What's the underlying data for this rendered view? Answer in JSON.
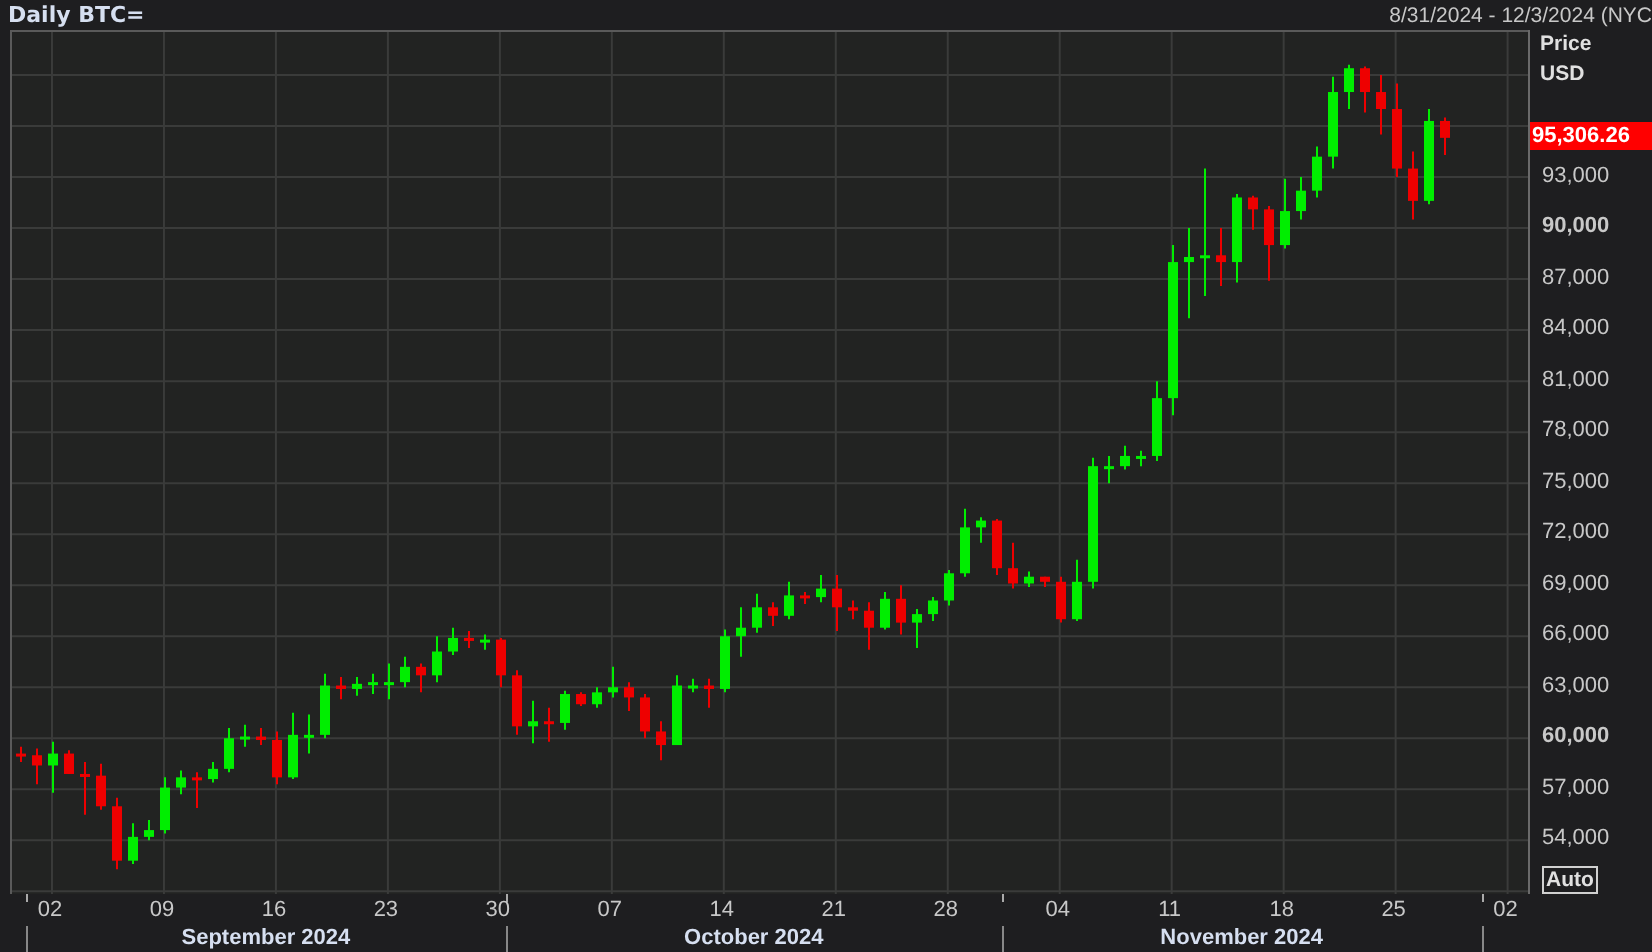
{
  "header": {
    "date_range": "8/31/2024 - 12/3/2024 (NYC"
  },
  "price_axis": {
    "title": "Price",
    "unit": "USD",
    "last_price": "95,306.26",
    "scale_mode": "Auto"
  },
  "months": [
    "September 2024",
    "October 2024",
    "November 2024"
  ],
  "chart": {
    "chart_data": {
      "type": "candlestick",
      "title": "Daily BTC=",
      "grid": true,
      "x": [
        "2024-08-31",
        "2024-09-01",
        "2024-09-02",
        "2024-09-03",
        "2024-09-04",
        "2024-09-05",
        "2024-09-06",
        "2024-09-07",
        "2024-09-08",
        "2024-09-09",
        "2024-09-10",
        "2024-09-11",
        "2024-09-12",
        "2024-09-13",
        "2024-09-14",
        "2024-09-15",
        "2024-09-16",
        "2024-09-17",
        "2024-09-18",
        "2024-09-19",
        "2024-09-20",
        "2024-09-21",
        "2024-09-22",
        "2024-09-23",
        "2024-09-24",
        "2024-09-25",
        "2024-09-26",
        "2024-09-27",
        "2024-09-28",
        "2024-09-29",
        "2024-09-30",
        "2024-10-01",
        "2024-10-02",
        "2024-10-03",
        "2024-10-04",
        "2024-10-05",
        "2024-10-06",
        "2024-10-07",
        "2024-10-08",
        "2024-10-09",
        "2024-10-10",
        "2024-10-11",
        "2024-10-12",
        "2024-10-13",
        "2024-10-14",
        "2024-10-15",
        "2024-10-16",
        "2024-10-17",
        "2024-10-18",
        "2024-10-19",
        "2024-10-20",
        "2024-10-21",
        "2024-10-22",
        "2024-10-23",
        "2024-10-24",
        "2024-10-25",
        "2024-10-26",
        "2024-10-27",
        "2024-10-28",
        "2024-10-29",
        "2024-10-30",
        "2024-10-31",
        "2024-11-01",
        "2024-11-02",
        "2024-11-03",
        "2024-11-04",
        "2024-11-05",
        "2024-11-06",
        "2024-11-07",
        "2024-11-08",
        "2024-11-09",
        "2024-11-10",
        "2024-11-11",
        "2024-11-12",
        "2024-11-13",
        "2024-11-14",
        "2024-11-15",
        "2024-11-16",
        "2024-11-17",
        "2024-11-18",
        "2024-11-19",
        "2024-11-20",
        "2024-11-21",
        "2024-11-22",
        "2024-11-23",
        "2024-11-24",
        "2024-11-25",
        "2024-11-26",
        "2024-11-27",
        "2024-11-28"
      ],
      "ohlc": [
        [
          59100,
          59500,
          58600,
          59000
        ],
        [
          59000,
          59400,
          57300,
          58400
        ],
        [
          58400,
          59800,
          56800,
          59100
        ],
        [
          59100,
          59300,
          57900,
          57900
        ],
        [
          57900,
          58600,
          55500,
          57800
        ],
        [
          57800,
          58500,
          55800,
          56000
        ],
        [
          56000,
          56500,
          52300,
          52800
        ],
        [
          52800,
          55000,
          52600,
          54200
        ],
        [
          54200,
          55200,
          54000,
          54600
        ],
        [
          54600,
          57700,
          54400,
          57100
        ],
        [
          57100,
          58100,
          56700,
          57700
        ],
        [
          57700,
          58000,
          55900,
          57600
        ],
        [
          57600,
          58600,
          57400,
          58200
        ],
        [
          58200,
          60600,
          58000,
          60000
        ],
        [
          60000,
          60800,
          59500,
          60100
        ],
        [
          60100,
          60600,
          59600,
          59900
        ],
        [
          59900,
          60400,
          57300,
          57700
        ],
        [
          57700,
          61500,
          57600,
          60200
        ],
        [
          60200,
          61400,
          59100,
          60200
        ],
        [
          60200,
          63800,
          60000,
          63100
        ],
        [
          63100,
          63600,
          62300,
          62900
        ],
        [
          62900,
          63600,
          62500,
          63200
        ],
        [
          63200,
          63800,
          62600,
          63300
        ],
        [
          63300,
          64400,
          62300,
          63300
        ],
        [
          63300,
          64800,
          63000,
          64200
        ],
        [
          64200,
          64400,
          62700,
          63700
        ],
        [
          63700,
          66000,
          63300,
          65100
        ],
        [
          65100,
          66500,
          64900,
          65900
        ],
        [
          65900,
          66300,
          65300,
          65800
        ],
        [
          65800,
          66100,
          65200,
          65800
        ],
        [
          65800,
          65900,
          63000,
          63700
        ],
        [
          63700,
          64000,
          60200,
          60700
        ],
        [
          60700,
          62200,
          59700,
          61000
        ],
        [
          61000,
          61800,
          59800,
          60900
        ],
        [
          60900,
          62800,
          60500,
          62600
        ],
        [
          62600,
          62700,
          61900,
          62000
        ],
        [
          62000,
          63000,
          61800,
          62700
        ],
        [
          62700,
          64200,
          62400,
          63000
        ],
        [
          63000,
          63300,
          61600,
          62400
        ],
        [
          62400,
          62600,
          60000,
          60400
        ],
        [
          60400,
          61000,
          58700,
          59600
        ],
        [
          59600,
          63700,
          59600,
          63100
        ],
        [
          63100,
          63500,
          62700,
          63100
        ],
        [
          63100,
          63500,
          61800,
          62900
        ],
        [
          62900,
          66400,
          62700,
          66000
        ],
        [
          66000,
          67700,
          64800,
          66500
        ],
        [
          66500,
          68500,
          66200,
          67700
        ],
        [
          67700,
          68000,
          66600,
          67200
        ],
        [
          67200,
          69200,
          67000,
          68400
        ],
        [
          68400,
          68600,
          67900,
          68300
        ],
        [
          68300,
          69600,
          68000,
          68800
        ],
        [
          68800,
          69600,
          66300,
          67700
        ],
        [
          67700,
          68100,
          67000,
          67500
        ],
        [
          67500,
          68000,
          65200,
          66500
        ],
        [
          66500,
          68600,
          66400,
          68200
        ],
        [
          68200,
          69000,
          66100,
          66800
        ],
        [
          66800,
          67600,
          65300,
          67300
        ],
        [
          67300,
          68300,
          66900,
          68100
        ],
        [
          68100,
          69900,
          67800,
          69700
        ],
        [
          69700,
          73500,
          69500,
          72400
        ],
        [
          72400,
          73000,
          71500,
          72800
        ],
        [
          72800,
          72900,
          69600,
          70000
        ],
        [
          70000,
          71500,
          68800,
          69100
        ],
        [
          69100,
          69800,
          68900,
          69500
        ],
        [
          69500,
          69500,
          68900,
          69200
        ],
        [
          69200,
          69500,
          66800,
          67000
        ],
        [
          67000,
          70500,
          66900,
          69200
        ],
        [
          69200,
          76500,
          68800,
          76000
        ],
        [
          76000,
          76600,
          75000,
          76000
        ],
        [
          76000,
          77200,
          75800,
          76600
        ],
        [
          76600,
          76900,
          76000,
          76600
        ],
        [
          76600,
          81000,
          76300,
          80000
        ],
        [
          80000,
          89000,
          79000,
          88000
        ],
        [
          88000,
          90000,
          84700,
          88300
        ],
        [
          88300,
          93500,
          86000,
          88400
        ],
        [
          88400,
          90000,
          86600,
          88000
        ],
        [
          88000,
          92000,
          86800,
          91800
        ],
        [
          91800,
          91900,
          89900,
          91100
        ],
        [
          91100,
          91300,
          86900,
          89000
        ],
        [
          89000,
          92900,
          88800,
          91000
        ],
        [
          91000,
          93000,
          90500,
          92200
        ],
        [
          92200,
          94800,
          91800,
          94200
        ],
        [
          94200,
          98900,
          93500,
          98000
        ],
        [
          98000,
          99600,
          97000,
          99400
        ],
        [
          99400,
          99500,
          96800,
          98000
        ],
        [
          98000,
          99000,
          95500,
          97000
        ],
        [
          97000,
          98500,
          93000,
          93500
        ],
        [
          93500,
          94500,
          90500,
          91600
        ],
        [
          91600,
          97000,
          91400,
          96300
        ],
        [
          96300,
          96500,
          94300,
          95306
        ]
      ],
      "xlim": [
        "2024-08-30T12:00:00Z",
        "2024-12-03T09:36:00Z"
      ],
      "ylim": [
        50724,
        101530
      ],
      "xticks": [
        {
          "value": "2024-09-02",
          "label": "02"
        },
        {
          "value": "2024-09-09",
          "label": "09"
        },
        {
          "value": "2024-09-16",
          "label": "16"
        },
        {
          "value": "2024-09-23",
          "label": "23"
        },
        {
          "value": "2024-09-30",
          "label": "30"
        },
        {
          "value": "2024-10-07",
          "label": "07"
        },
        {
          "value": "2024-10-14",
          "label": "14"
        },
        {
          "value": "2024-10-21",
          "label": "21"
        },
        {
          "value": "2024-10-28",
          "label": "28"
        },
        {
          "value": "2024-11-04",
          "label": "04"
        },
        {
          "value": "2024-11-11",
          "label": "11"
        },
        {
          "value": "2024-11-18",
          "label": "18"
        },
        {
          "value": "2024-11-25",
          "label": "25"
        },
        {
          "value": "2024-12-02",
          "label": "02"
        }
      ],
      "yticks": [
        {
          "value": 54000,
          "label": "54,000"
        },
        {
          "value": 57000,
          "label": "57,000"
        },
        {
          "value": 60000,
          "label": "60,000"
        },
        {
          "value": 63000,
          "label": "63,000"
        },
        {
          "value": 66000,
          "label": "66,000"
        },
        {
          "value": 69000,
          "label": "69,000"
        },
        {
          "value": 72000,
          "label": "72,000"
        },
        {
          "value": 75000,
          "label": "75,000"
        },
        {
          "value": 78000,
          "label": "78,000"
        },
        {
          "value": 81000,
          "label": "81,000"
        },
        {
          "value": 84000,
          "label": "84,000"
        },
        {
          "value": 87000,
          "label": "87,000"
        },
        {
          "value": 90000,
          "label": "90,000"
        },
        {
          "value": 93000,
          "label": "93,000"
        }
      ]
    }
  }
}
